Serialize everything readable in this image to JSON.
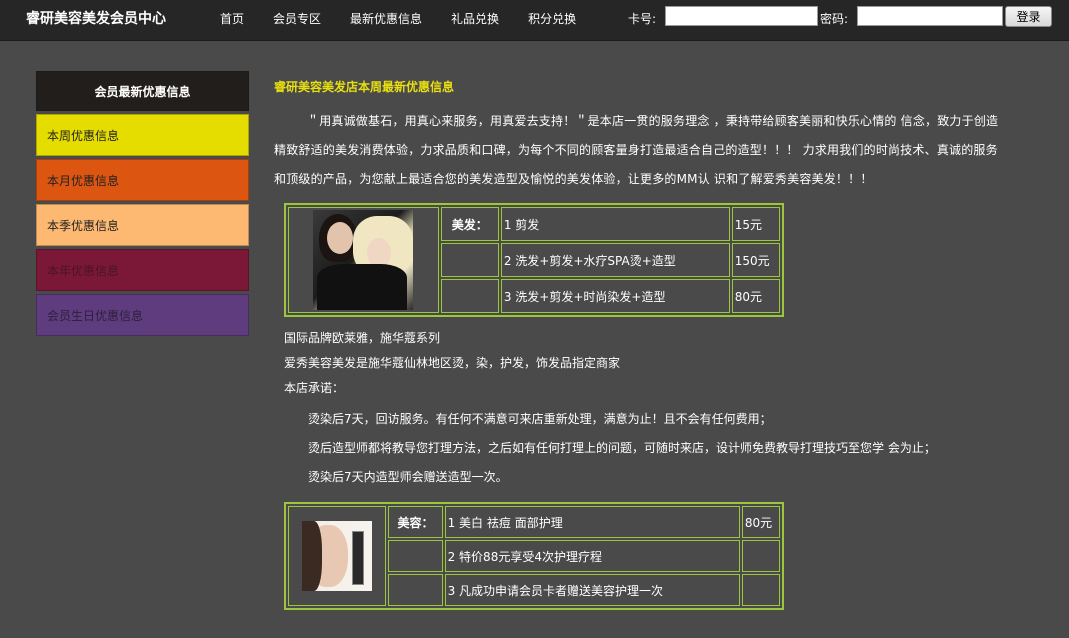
{
  "header": {
    "site_title": "睿研美容美发会员中心",
    "nav": [
      "首页",
      "会员专区",
      "最新优惠信息",
      "礼品兑换",
      "积分兑换"
    ],
    "card_label": "卡号:",
    "password_label": "密码:",
    "card_value": "",
    "password_value": "",
    "login_button": "登录"
  },
  "sidebar": {
    "header": "会员最新优惠信息",
    "items": [
      {
        "label": "本周优惠信息",
        "color": "#e5dc00"
      },
      {
        "label": "本月优惠信息",
        "color": "#dc5511"
      },
      {
        "label": "本季优惠信息",
        "color": "#fdb872"
      },
      {
        "label": "本年优惠信息",
        "color": "#7b1838"
      },
      {
        "label": "会员生日优惠信息",
        "color": "#5e3c7d"
      }
    ]
  },
  "main": {
    "title": "睿研美容美发店本周最新优惠信息",
    "intro": "＂用真诚做基石，用真心来服务，用真爱去支持！＂是本店一贯的服务理念 ，秉持带给顾客美丽和快乐心情的 信念，致力于创造精致舒适的美发消费体验，力求品质和口碑，为每个不同的顾客量身打造最适合自己的造型！！！ 力求用我们的时尚技术、真诚的服务和顶级的产品，为您献上最适合您的美发造型及愉悦的美发体验，让更多的MM认 识和了解爱秀美容美发！！！",
    "hair_table": {
      "label": "美发：",
      "rows": [
        {
          "item": "1 剪发",
          "price": "15元"
        },
        {
          "item": "2 洗发+剪发+水疗SPA烫+造型",
          "price": "150元"
        },
        {
          "item": "3 洗发+剪发+时尚染发+造型",
          "price": "80元"
        }
      ]
    },
    "notes": [
      "国际品牌欧莱雅，施华蔻系列",
      "爱秀美容美发是施华蔻仙林地区烫，染，护发，饰发品指定商家",
      "本店承诺："
    ],
    "promises": [
      "烫染后7天，回访服务。有任何不满意可来店重新处理，满意为止！且不会有任何费用；",
      "烫后造型师都将教导您打理方法，之后如有任何打理上的问题，可随时来店，设计师免费教导打理技巧至您学 会为止；",
      "烫染后7天内造型师会赠送造型一次。"
    ],
    "beauty_table": {
      "label": "美容：",
      "rows": [
        {
          "item": "1 美白 祛痘 面部护理",
          "price": "80元"
        },
        {
          "item": "2 特价88元享受4次护理疗程",
          "price": ""
        },
        {
          "item": "3 凡成功申请会员卡者赠送美容护理一次",
          "price": ""
        }
      ]
    }
  }
}
